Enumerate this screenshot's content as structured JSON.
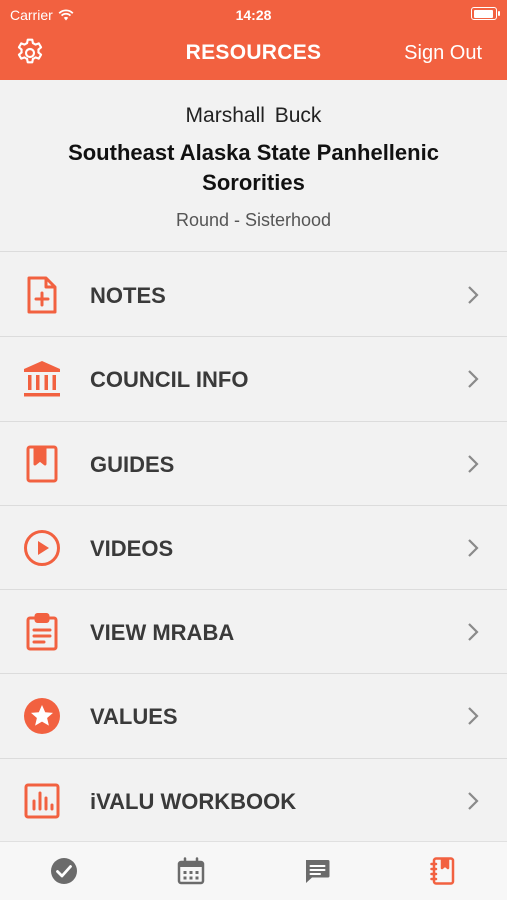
{
  "status_bar": {
    "carrier": "Carrier",
    "time": "14:28",
    "battery_level": 0.95
  },
  "nav": {
    "title": "RESOURCES",
    "sign_out": "Sign Out"
  },
  "profile": {
    "user_name": "Marshall  Buck",
    "org_name": "Southeast Alaska State Panhellenic Sororities",
    "round": "Round - Sisterhood"
  },
  "menu": [
    {
      "label": "NOTES",
      "icon": "note-add-icon"
    },
    {
      "label": "COUNCIL INFO",
      "icon": "bank-icon"
    },
    {
      "label": "GUIDES",
      "icon": "book-bookmark-icon"
    },
    {
      "label": "VIDEOS",
      "icon": "play-circle-icon"
    },
    {
      "label": "VIEW MRABA",
      "icon": "clipboard-icon"
    },
    {
      "label": "VALUES",
      "icon": "star-badge-icon"
    },
    {
      "label": "iVALU WORKBOOK",
      "icon": "bar-chart-icon"
    }
  ],
  "tabs": [
    {
      "icon": "check-circle-icon",
      "active": false
    },
    {
      "icon": "calendar-icon",
      "active": false
    },
    {
      "icon": "chat-icon",
      "active": false
    },
    {
      "icon": "notebook-icon",
      "active": true
    }
  ],
  "colors": {
    "accent": "#f26140",
    "tab_inactive": "#6b6b6b",
    "text": "#3a3a3a"
  }
}
